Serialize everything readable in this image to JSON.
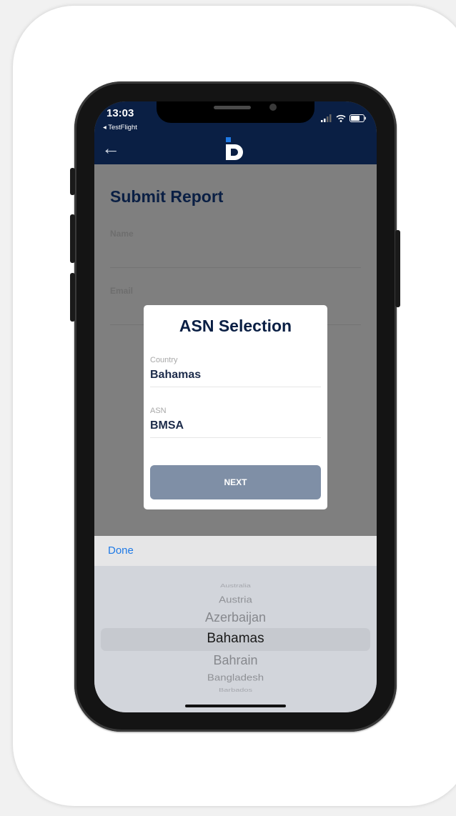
{
  "status": {
    "time": "13:03",
    "back_app": "◂ TestFlight"
  },
  "nav": {
    "back_icon": "arrow-left-icon",
    "logo_icon": "d-logo-icon"
  },
  "page": {
    "title": "Submit Report",
    "name_label": "Name",
    "email_label": "Email"
  },
  "modal": {
    "title": "ASN Selection",
    "country_label": "Country",
    "country_value": "Bahamas",
    "asn_label": "ASN",
    "asn_value": "BMSA",
    "next_label": "NEXT"
  },
  "toolbar": {
    "done_label": "Done"
  },
  "picker": {
    "selected": "Bahamas",
    "items": [
      "Australia",
      "Austria",
      "Azerbaijan",
      "Bahamas",
      "Bahrain",
      "Bangladesh",
      "Barbados"
    ]
  },
  "colors": {
    "nav_bg": "#0a1f44",
    "accent": "#1f7ae6",
    "button": "#7f8fa6"
  }
}
